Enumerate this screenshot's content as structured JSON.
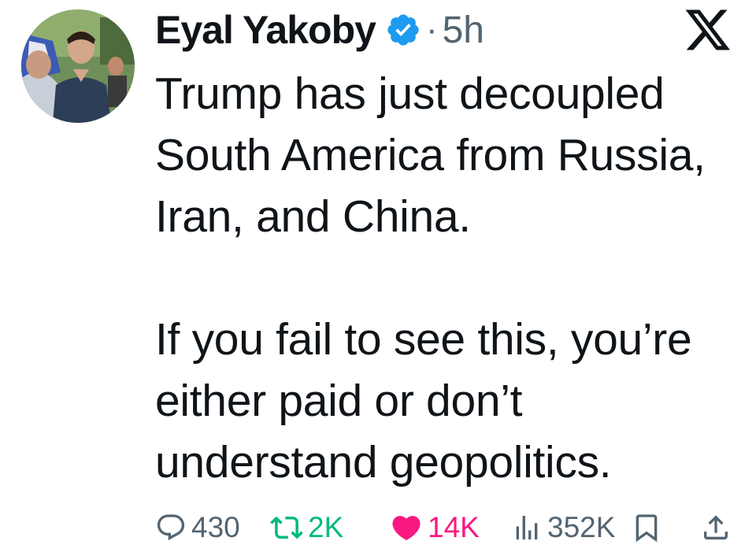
{
  "author": {
    "name": "Eyal Yakoby",
    "verified_icon": "verified-badge-icon",
    "separator": "·",
    "time_ago": "5h"
  },
  "platform_logo": "x-logo-icon",
  "post": {
    "paragraphs": [
      "Trump has just decoupled South America from Russia, Iran, and China.",
      "If you fail to see this, you’re either paid or don’t understand geopolitics."
    ]
  },
  "actions": {
    "replies": "430",
    "reposts": "2K",
    "likes": "14K",
    "views": "352K"
  },
  "colors": {
    "text": "#0f1419",
    "muted": "#536471",
    "verified": "#1d9bf0",
    "retweet": "#00ba7c",
    "like": "#f91880"
  }
}
